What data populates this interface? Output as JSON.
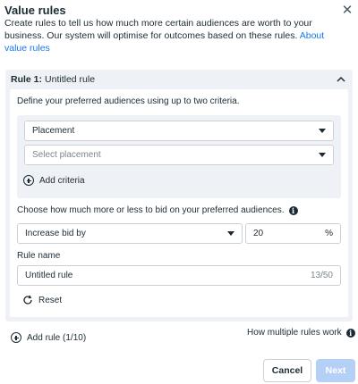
{
  "dialog": {
    "title": "Value rules",
    "description": "Create rules to tell us how much more certain audiences are worth to your business. Our system will optimise for outcomes based on these rules.",
    "about_link": "About value rules",
    "close_icon": "close-icon"
  },
  "rule": {
    "header_prefix": "Rule 1:",
    "header_name": "Untitled rule",
    "criteria_label": "Define your preferred audiences using up to two criteria.",
    "criteria_select_value": "Placement",
    "placement_select_placeholder": "Select placement",
    "add_criteria_label": "Add criteria",
    "bid_label": "Choose how much more or less to bid on your preferred audiences.",
    "bid_adjust_value": "Increase bid by",
    "bid_percent_value": "20",
    "bid_percent_unit": "%",
    "name_label": "Rule name",
    "name_value": "Untitled rule",
    "name_char_count": "13/50",
    "reset_label": "Reset"
  },
  "footer": {
    "add_rule_label": "Add rule (1/10)",
    "how_link": "How multiple rules work",
    "cancel_label": "Cancel",
    "next_label": "Next"
  },
  "colors": {
    "link": "#1877f2",
    "panel_bg": "#eef1f6",
    "next_disabled": "#b5d0f7"
  }
}
